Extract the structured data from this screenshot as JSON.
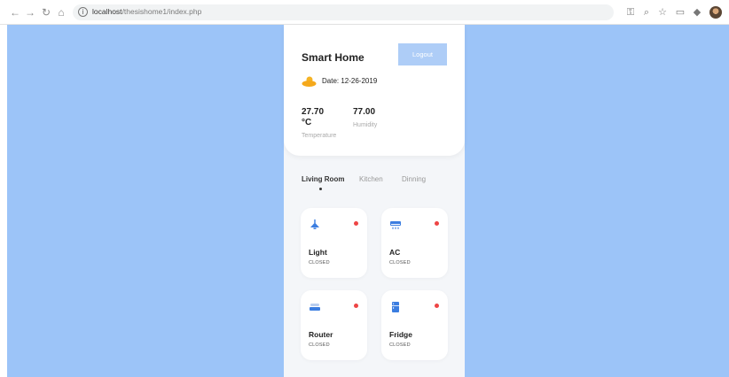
{
  "browser": {
    "url_host": "localhost",
    "url_path": "/thesishome1/index.php"
  },
  "app": {
    "title": "Smart Home",
    "logout_label": "Logout",
    "date_text": "Date: 12-26-2019",
    "temperature": {
      "value": "27.70",
      "unit": "°C",
      "label": "Temperature"
    },
    "humidity": {
      "value": "77.00",
      "label": "Humidity"
    }
  },
  "tabs": [
    {
      "label": "Living Room",
      "active": true
    },
    {
      "label": "Kitchen",
      "active": false
    },
    {
      "label": "Dinning",
      "active": false
    }
  ],
  "devices": [
    {
      "name": "Light",
      "state": "CLOSED",
      "icon": "lamp-icon"
    },
    {
      "name": "AC",
      "state": "CLOSED",
      "icon": "ac-icon"
    },
    {
      "name": "Router",
      "state": "CLOSED",
      "icon": "router-icon"
    },
    {
      "name": "Fridge",
      "state": "CLOSED",
      "icon": "fridge-icon"
    }
  ],
  "colors": {
    "background": "#9cc4f8",
    "logout_button": "#aecdf7",
    "icon_blue": "#3b7de0",
    "status_off": "#ee4545",
    "sun": "#f5b324"
  }
}
